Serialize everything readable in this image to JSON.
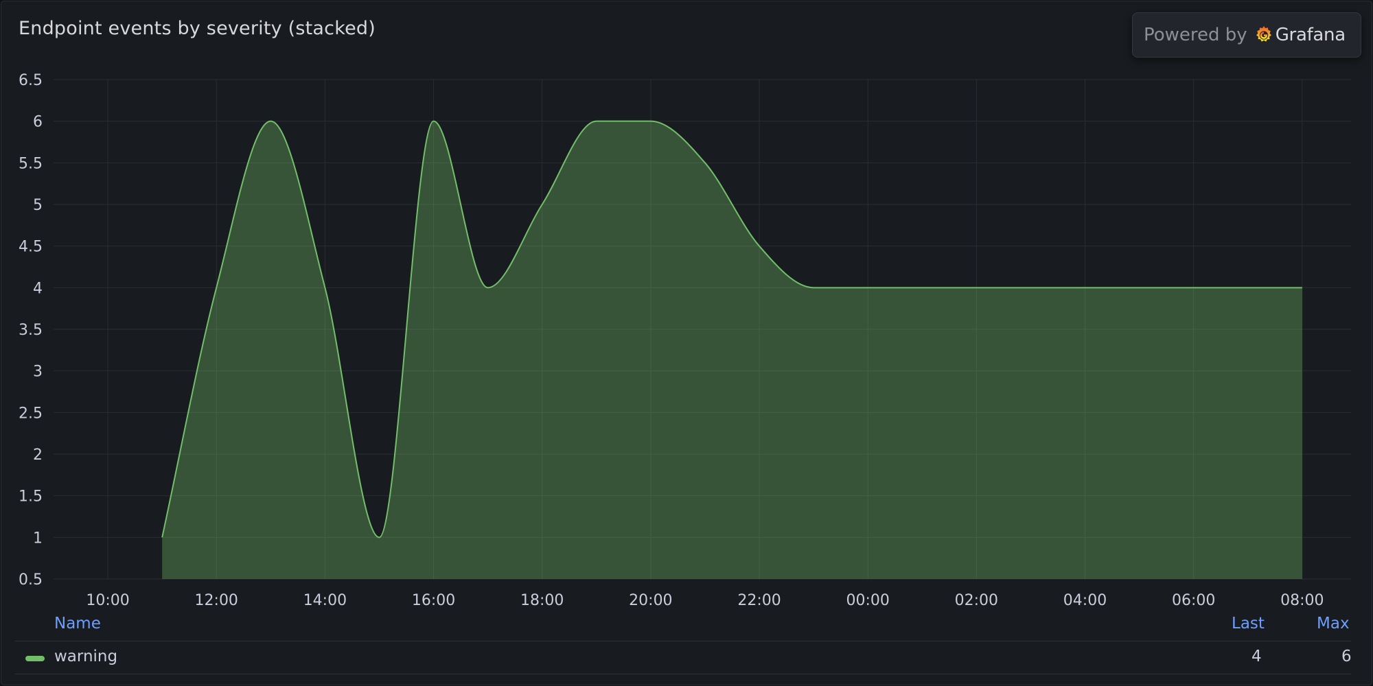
{
  "panel": {
    "title": "Endpoint events by severity (stacked)"
  },
  "powered_by": {
    "label": "Powered by",
    "brand": "Grafana",
    "icon": "grafana-logo-icon"
  },
  "legend": {
    "headers": {
      "name": "Name",
      "last": "Last",
      "max": "Max"
    },
    "rows": [
      {
        "name": "warning",
        "last": "4",
        "max": "6",
        "color": "#73bf69"
      }
    ]
  },
  "chart_data": {
    "type": "area",
    "title": "Endpoint events by severity (stacked)",
    "xlabel": "",
    "ylabel": "",
    "ylim": [
      0.5,
      6.5
    ],
    "y_ticks": [
      0.5,
      1,
      1.5,
      2,
      2.5,
      3,
      3.5,
      4,
      4.5,
      5,
      5.5,
      6,
      6.5
    ],
    "y_tick_labels": [
      "0.5",
      "1",
      "1.5",
      "2",
      "2.5",
      "3",
      "3.5",
      "4",
      "4.5",
      "5",
      "5.5",
      "6",
      "6.5"
    ],
    "x_range_hours": [
      9.0,
      32.9
    ],
    "x_ticks": [
      10,
      12,
      14,
      16,
      18,
      20,
      22,
      24,
      26,
      28,
      30,
      32
    ],
    "x_tick_labels": [
      "10:00",
      "12:00",
      "14:00",
      "16:00",
      "18:00",
      "20:00",
      "22:00",
      "00:00",
      "02:00",
      "04:00",
      "06:00",
      "08:00"
    ],
    "grid": true,
    "legend_position": "bottom",
    "series": [
      {
        "name": "warning",
        "color": "#73bf69",
        "x": [
          "11:00",
          "12:00",
          "13:00",
          "14:00",
          "15:00",
          "16:00",
          "17:00",
          "18:00",
          "19:00",
          "20:00",
          "21:00",
          "22:00",
          "23:00",
          "00:00",
          "01:00",
          "02:00",
          "03:00",
          "04:00",
          "05:00",
          "06:00",
          "07:00",
          "08:00"
        ],
        "x_hours": [
          11,
          12,
          13,
          14,
          15,
          16,
          17,
          18,
          19,
          20,
          21,
          22,
          23,
          24,
          25,
          26,
          27,
          28,
          29,
          30,
          31,
          32
        ],
        "values": [
          1,
          4,
          6,
          4,
          1,
          6,
          4,
          5,
          6,
          6,
          5.5,
          4.5,
          4,
          4,
          4,
          4,
          4,
          4,
          4,
          4,
          4,
          4
        ]
      }
    ]
  }
}
